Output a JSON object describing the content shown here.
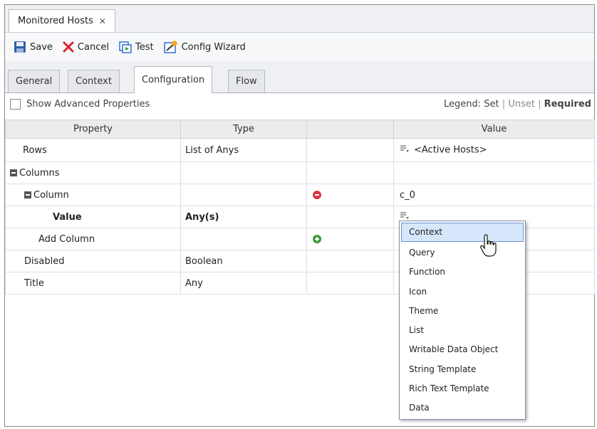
{
  "window": {
    "tab_title": "Monitored Hosts",
    "close_glyph": "✕"
  },
  "toolbar": {
    "save": "Save",
    "cancel": "Cancel",
    "test": "Test",
    "config_wizard": "Config Wizard"
  },
  "tabs": [
    "General",
    "Context",
    "Configuration",
    "Flow"
  ],
  "active_tab": "Configuration",
  "options": {
    "show_advanced_label": "Show Advanced Properties",
    "show_advanced_checked": false
  },
  "legend": {
    "prefix": "Legend:",
    "set": "Set",
    "unset": "Unset",
    "required": "Required",
    "separator": "|"
  },
  "columns": [
    "Property",
    "Type",
    "",
    "Value"
  ],
  "rows": [
    {
      "property": "Rows",
      "type": "List of Anys",
      "value": "<Active Hosts>"
    },
    {
      "property": "Columns"
    },
    {
      "property": "Column",
      "action": "remove",
      "value": "c_0"
    },
    {
      "property": "Value",
      "type": "Any(s)"
    },
    {
      "property": "Add Column",
      "action": "add"
    },
    {
      "property": "Disabled",
      "type": "Boolean"
    },
    {
      "property": "Title",
      "type": "Any"
    }
  ],
  "dropdown": {
    "items": [
      "Context",
      "Query",
      "Function",
      "Icon",
      "Theme",
      "List",
      "Writable Data Object",
      "String Template",
      "Rich Text Template",
      "Data"
    ],
    "highlighted": "Context"
  },
  "colors": {
    "accent_blue": "#2f6fd1",
    "cancel_red": "#d9262c",
    "remove_red": "#d9363e",
    "add_green": "#3a9a3a",
    "highlight": "#d6e6fb"
  }
}
